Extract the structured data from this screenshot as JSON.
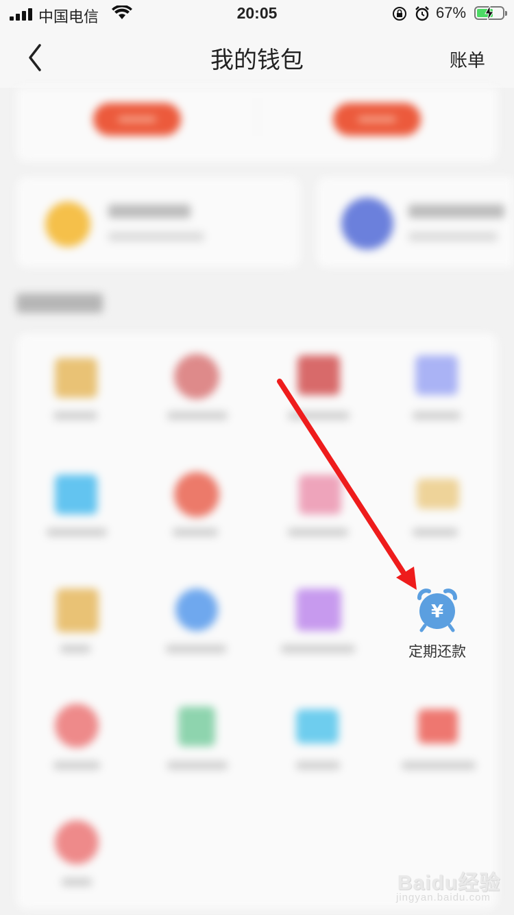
{
  "status_bar": {
    "carrier": "中国电信",
    "time": "20:05",
    "battery_percent": "67%",
    "battery_level": 0.67
  },
  "nav": {
    "title": "我的钱包",
    "right_link": "账单"
  },
  "services": {
    "highlighted_item": {
      "label": "定期还款",
      "icon": "alarm-clock-yuan-icon",
      "currency_symbol": "¥",
      "icon_color": "#5b9fe0"
    }
  },
  "watermark": {
    "brand": "Baidu经验",
    "url": "jingyan.baidu.com"
  },
  "colors": {
    "annotation_arrow": "#ee1c1c",
    "action_pill": "#ec5a3c"
  }
}
